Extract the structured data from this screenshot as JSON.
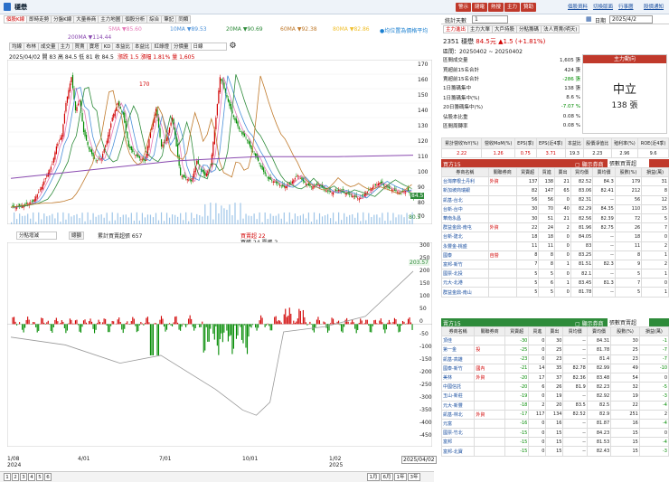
{
  "window": {
    "title": "穩懋"
  },
  "top_buttons": [
    "警示",
    "閉電",
    "熱搜",
    "主力",
    "贊助"
  ],
  "top_links": [
    "個股資料",
    "切換版面",
    "行事曆",
    "股價通知"
  ],
  "left_tabs": [
    "個股K線",
    "即時走勢",
    "分盤K線",
    "大量券商",
    "主力地圖",
    "個股分析",
    "綜合",
    "筆記",
    "同類"
  ],
  "ma": [
    {
      "label": "5MA ▼85.60",
      "color": "#e57ab8"
    },
    {
      "label": "10MA ▼89.53",
      "color": "#4a90d9"
    },
    {
      "label": "20MA ▼90.69",
      "color": "#2e8b3a"
    },
    {
      "label": "60MA ▼92.38",
      "color": "#c07a2c"
    },
    {
      "label": "80MA ▼82.86",
      "color": "#f0c030"
    },
    {
      "label": "200MA ▼114.44",
      "color": "#8a4ab0"
    }
  ],
  "ma_note": "●均位置為價格平均",
  "chart_tabs": [
    "均線",
    "布林",
    "成交量",
    "主力",
    "買賣",
    "寶塔",
    "KD",
    "本益比",
    "本益比",
    "紅綠燈",
    "分價量"
  ],
  "period": "日線",
  "ohlc": "2025/04/02 開 83 高 84.5 低 81 收 84.5",
  "change": "漲跌 1.5 漲幅 1.81% 量 1,605",
  "price_axis": [
    "170",
    "160",
    "150",
    "140",
    "130",
    "120",
    "110",
    "100",
    "90",
    "80",
    "70"
  ],
  "current_price_tag": "84.5",
  "low_tag": "80.5",
  "peak_label": "170",
  "lower_select": "分點增減",
  "lower_button": "總額",
  "lower_legend": {
    "cum": "累計買賣超張 657",
    "buy": "買賣超 22",
    "range": "買張 24 賣張 2"
  },
  "lower_axis": [
    "300",
    "250",
    "200",
    "150",
    "100",
    "50",
    "0",
    "-50",
    "-100",
    "-150",
    "-200",
    "-250",
    "-300",
    "-350",
    "-400",
    "-450"
  ],
  "lower_tag": "203.57",
  "x_axis": [
    {
      "label": "1/08",
      "sub": "2024"
    },
    {
      "label": "4/01",
      "sub": ""
    },
    {
      "label": "7/01",
      "sub": ""
    },
    {
      "label": "10/01",
      "sub": ""
    },
    {
      "label": "1/02",
      "sub": "2025"
    }
  ],
  "date_box": "2025/04/02",
  "pages": [
    "1",
    "2",
    "3",
    "4",
    "5",
    "6"
  ],
  "ranges": [
    "1月",
    "6月",
    "1年",
    "3年"
  ],
  "right": {
    "stat_label": "統計天數",
    "stat_value": "1",
    "date_label": "日期",
    "date_value": "2025/4/2",
    "tabs": [
      "主力進出",
      "主力大單",
      "大戶持股",
      "分點籌碼",
      "法人買賣(明天)"
    ],
    "stock": "2351 穩懋",
    "price": "84.5元",
    "chg": "▲1.5 (+1.81%)",
    "range": "區間：20250402 ~ 20250402",
    "stats": [
      [
        "區間成交量",
        "1,605 張"
      ],
      [
        "買超前15名合計",
        "424 張"
      ],
      [
        "賣超前15名合計",
        "-286 張"
      ],
      [
        "1日籌碼集中",
        "138 張"
      ],
      [
        "1日籌碼集中(%)",
        "8.6 %"
      ],
      [
        "20日籌碼集中(%)",
        "-7.07 %"
      ],
      [
        "佔股本比重",
        "0.08 %"
      ],
      [
        "區間周轉率",
        "0.08 %"
      ]
    ],
    "trend_title": "主力動向",
    "trend_word": "中立",
    "trend_val": "138 張",
    "fin_heads": [
      "累計營收YoY(%)",
      "營收MoM(%)",
      "EPS(季)",
      "EPS(近4季)",
      "本益比",
      "股價淨值比",
      "殖利率(%)",
      "ROE(近4季)"
    ],
    "fin_vals": [
      "2.22",
      "1.26",
      "0.75",
      "3.71",
      "19.3",
      "2.23",
      "2.96",
      "9.6"
    ],
    "buy_title": "買方15",
    "sell_title": "賣方15",
    "only_label": "▢ 顯示券商",
    "select": "張數買賣超",
    "cols": [
      "券商名稱",
      "關聯券商",
      "買賣超",
      "買進",
      "賣出",
      "買均價",
      "賣均價",
      "股數(%)",
      "損益(萬)"
    ],
    "buys": [
      [
        "台灣摩根士丹利",
        "外資",
        "137",
        "138",
        "21",
        "82.52",
        "84.3",
        "179",
        "31"
      ],
      [
        "新加坡商瑞銀",
        "",
        "82",
        "147",
        "65",
        "83.06",
        "82.41",
        "212",
        "8"
      ],
      [
        "凱基-台北",
        "",
        "56",
        "56",
        "0",
        "82.31",
        "--",
        "56",
        "12"
      ],
      [
        "台新-台中",
        "",
        "30",
        "70",
        "40",
        "82.29",
        "84.35",
        "110",
        "15"
      ],
      [
        "華南永昌",
        "",
        "30",
        "51",
        "21",
        "82.56",
        "82.39",
        "72",
        "5"
      ],
      [
        "群益金鼎-南屯",
        "外資",
        "22",
        "24",
        "2",
        "81.96",
        "82.75",
        "26",
        "7"
      ],
      [
        "台新-建北",
        "",
        "18",
        "18",
        "0",
        "84.05",
        "--",
        "18",
        "0"
      ],
      [
        "永豐金-桃盛",
        "",
        "11",
        "11",
        "0",
        "83",
        "--",
        "11",
        "2"
      ],
      [
        "國泰",
        "自營",
        "8",
        "8",
        "0",
        "83.25",
        "--",
        "8",
        "1"
      ],
      [
        "富邦-新竹",
        "",
        "7",
        "8",
        "1",
        "81.51",
        "82.3",
        "9",
        "2"
      ],
      [
        "國票-北投",
        "",
        "5",
        "5",
        "0",
        "82.1",
        "--",
        "5",
        "1"
      ],
      [
        "元大-北港",
        "",
        "5",
        "6",
        "1",
        "83.45",
        "81.3",
        "7",
        "0"
      ],
      [
        "群益金鼎-南山",
        "",
        "5",
        "5",
        "0",
        "81.78",
        "--",
        "5",
        "1"
      ]
    ],
    "sells": [
      [
        "頂佳",
        "",
        "-30",
        "0",
        "30",
        "--",
        "84.31",
        "30",
        "-1"
      ],
      [
        "第一金",
        "投",
        "-25",
        "0",
        "25",
        "--",
        "81.78",
        "25",
        "-7"
      ],
      [
        "凱基-高雄",
        "",
        "-23",
        "0",
        "23",
        "--",
        "81.4",
        "23",
        "-7"
      ],
      [
        "國泰-新竹",
        "國內",
        "-21",
        "14",
        "35",
        "82.78",
        "82.99",
        "49",
        "-10"
      ],
      [
        "美林",
        "外資",
        "-20",
        "17",
        "37",
        "82.36",
        "83.48",
        "54",
        "0"
      ],
      [
        "中國信託",
        "",
        "-20",
        "6",
        "26",
        "81.9",
        "82.23",
        "32",
        "-5"
      ],
      [
        "玉山-新莊",
        "",
        "-19",
        "0",
        "19",
        "--",
        "82.92",
        "19",
        "-3"
      ],
      [
        "元大-新豐",
        "",
        "-18",
        "2",
        "20",
        "83.5",
        "82.5",
        "22",
        "-4"
      ],
      [
        "凱基-林北",
        "外資",
        "-17",
        "117",
        "134",
        "82.52",
        "82.9",
        "251",
        "2"
      ],
      [
        "元富",
        "",
        "-16",
        "0",
        "16",
        "--",
        "81.87",
        "16",
        "-4"
      ],
      [
        "國票-竹北",
        "",
        "-15",
        "0",
        "15",
        "--",
        "84.23",
        "15",
        "0"
      ],
      [
        "富邦",
        "",
        "-15",
        "0",
        "15",
        "--",
        "81.53",
        "15",
        "-4"
      ],
      [
        "富邦-北寶",
        "",
        "-15",
        "0",
        "15",
        "--",
        "82.43",
        "15",
        "-3"
      ]
    ]
  },
  "chart_data": {
    "type": "line",
    "note_x": [
      "2024/01/08",
      "2024/04/01",
      "2024/07/01",
      "2024/10/01",
      "2025/01/02",
      "2025/04/02"
    ],
    "price": {
      "name": "收盤價",
      "points": [
        [
          0,
          78
        ],
        [
          8,
          79
        ],
        [
          16,
          82
        ],
        [
          22,
          92
        ],
        [
          26,
          100
        ],
        [
          30,
          108
        ],
        [
          33,
          120
        ],
        [
          37,
          128
        ],
        [
          40,
          150
        ],
        [
          44,
          168
        ],
        [
          47,
          145
        ],
        [
          50,
          152
        ],
        [
          53,
          130
        ],
        [
          57,
          118
        ],
        [
          62,
          110
        ],
        [
          66,
          112
        ],
        [
          70,
          124
        ],
        [
          74,
          140
        ],
        [
          78,
          150
        ],
        [
          82,
          142
        ],
        [
          86,
          120
        ],
        [
          90,
          115
        ],
        [
          94,
          112
        ],
        [
          98,
          110
        ],
        [
          102,
          130
        ],
        [
          106,
          146
        ],
        [
          110,
          120
        ],
        [
          114,
          126
        ],
        [
          118,
          140
        ],
        [
          121,
          120
        ],
        [
          124,
          100
        ],
        [
          128,
          98
        ],
        [
          132,
          96
        ],
        [
          136,
          110
        ],
        [
          139,
          104
        ],
        [
          142,
          100
        ],
        [
          146,
          106
        ],
        [
          150,
          140
        ],
        [
          153,
          168
        ],
        [
          156,
          160
        ],
        [
          160,
          148
        ],
        [
          164,
          138
        ],
        [
          168,
          130
        ],
        [
          172,
          126
        ],
        [
          176,
          118
        ],
        [
          180,
          112
        ],
        [
          184,
          104
        ],
        [
          188,
          98
        ],
        [
          192,
          96
        ],
        [
          196,
          94
        ],
        [
          200,
          92
        ],
        [
          205,
          95
        ],
        [
          210,
          100
        ],
        [
          215,
          95
        ],
        [
          220,
          92
        ],
        [
          225,
          94
        ],
        [
          230,
          90
        ],
        [
          235,
          88
        ],
        [
          240,
          90
        ],
        [
          245,
          88
        ],
        [
          250,
          86
        ],
        [
          255,
          84
        ],
        [
          260,
          88
        ],
        [
          265,
          92
        ],
        [
          270,
          95
        ],
        [
          275,
          92
        ],
        [
          280,
          90
        ],
        [
          285,
          88
        ],
        [
          290,
          90
        ],
        [
          295,
          84.5
        ]
      ]
    },
    "ma200": {
      "name": "200MA",
      "points": [
        [
          0,
          98
        ],
        [
          60,
          104
        ],
        [
          120,
          110
        ],
        [
          180,
          113
        ],
        [
          240,
          113
        ],
        [
          295,
          114
        ]
      ]
    },
    "lower_cum": [
      [
        0,
        -50
      ],
      [
        40,
        -80
      ],
      [
        80,
        -150
      ],
      [
        110,
        -120
      ],
      [
        150,
        -250
      ],
      [
        170,
        -330
      ],
      [
        180,
        -350
      ],
      [
        190,
        -300
      ],
      [
        200,
        -30
      ],
      [
        230,
        -10
      ],
      [
        260,
        30
      ],
      [
        295,
        203
      ]
    ],
    "ylim_price": [
      70,
      175
    ],
    "ylim_lower": [
      -450,
      300
    ]
  }
}
